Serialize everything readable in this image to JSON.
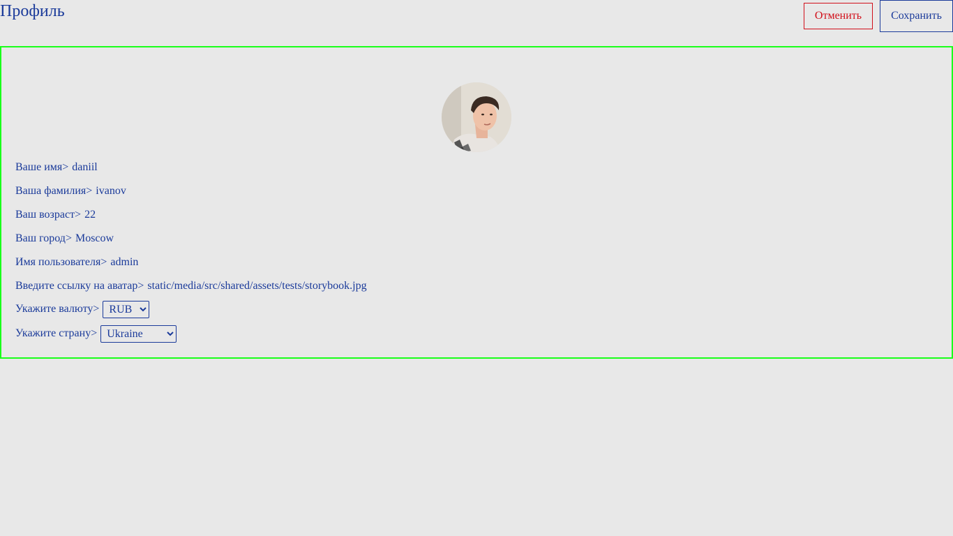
{
  "header": {
    "title": "Профиль",
    "cancel_label": "Отменить",
    "save_label": "Сохранить"
  },
  "profile": {
    "first_name": {
      "label": "Ваше имя>",
      "value": "daniil"
    },
    "last_name": {
      "label": "Ваша фамилия>",
      "value": "ivanov"
    },
    "age": {
      "label": "Ваш возраст>",
      "value": "22"
    },
    "city": {
      "label": "Ваш город>",
      "value": "Moscow"
    },
    "username": {
      "label": "Имя пользователя>",
      "value": "admin"
    },
    "avatar": {
      "label": "Введите ссылку на аватар>",
      "value": "static/media/src/shared/assets/tests/storybook.jpg"
    },
    "currency": {
      "label": "Укажите валюту>",
      "selected": "RUB"
    },
    "country": {
      "label": "Укажите страну>",
      "selected": "Ukraine"
    }
  },
  "colors": {
    "text": "#1a3a9a",
    "cancel": "#d10f1a",
    "card_border": "#1aff1a",
    "background": "#e8e8e8"
  }
}
